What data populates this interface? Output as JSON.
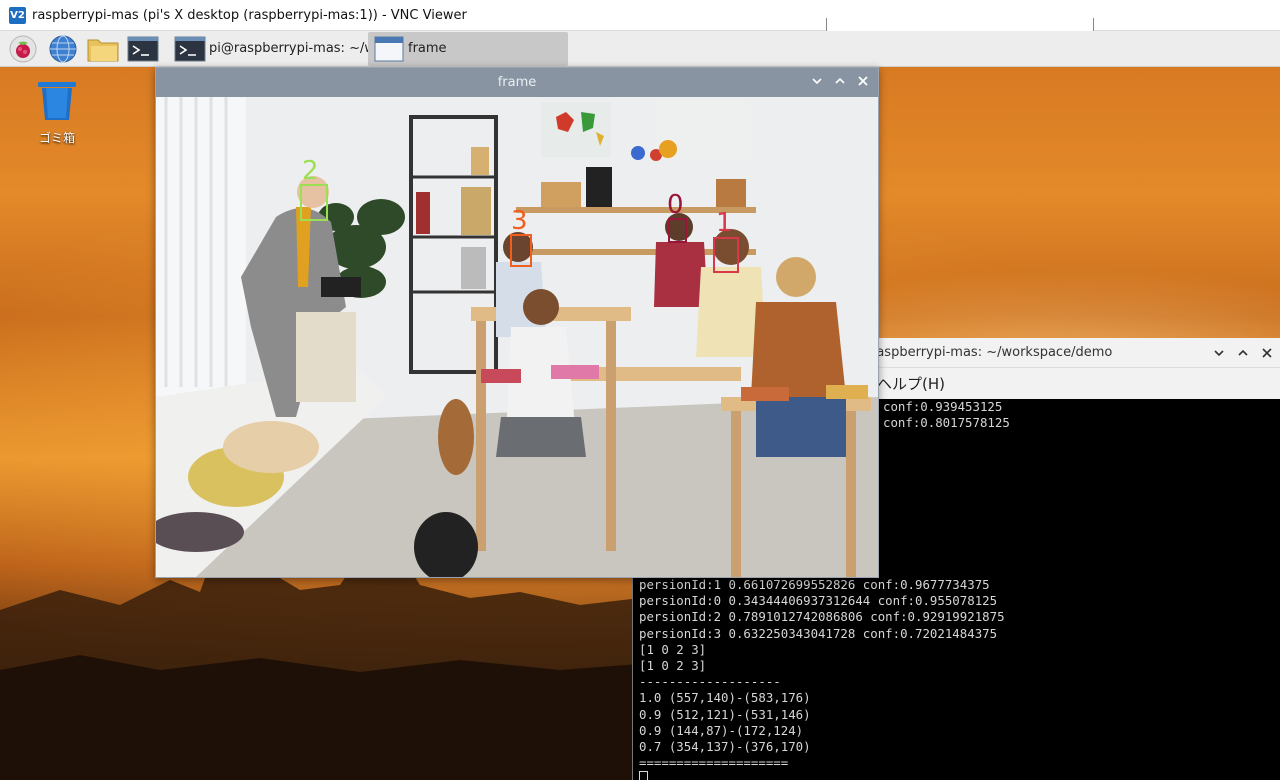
{
  "vnc": {
    "title": "raspberrypi-mas (pi's X desktop (raspberrypi-mas:1)) - VNC Viewer",
    "logo_text": "V2"
  },
  "panel": {
    "launchers": [
      "raspberry-menu-icon",
      "web-browser-icon",
      "file-manager-icon",
      "terminal-launcher-icon"
    ],
    "tasks": [
      {
        "label": "pi@raspberrypi-mas: ~/wo...",
        "icon": "terminal-icon"
      },
      {
        "label": "frame",
        "icon": "window-icon"
      }
    ]
  },
  "desktop": {
    "trash_label": "ゴミ箱"
  },
  "frame": {
    "title": "frame",
    "detections": [
      {
        "label": "2",
        "color": "#9be052"
      },
      {
        "label": "3",
        "color": "#f0601c"
      },
      {
        "label": "0",
        "color": "#9a1538"
      },
      {
        "label": "1",
        "color": "#d8384a"
      }
    ]
  },
  "terminal": {
    "title": "raspberrypi-mas: ~/workspace/demo",
    "menu": "ヘルプ(H)",
    "top_lines": [
      "conf:0.939453125",
      "conf:0.8017578125"
    ],
    "lines": [
      "persionId:1 0.661072699552826 conf:0.9677734375",
      "persionId:0 0.34344406937312644 conf:0.955078125",
      "persionId:2 0.7891012742086806 conf:0.92919921875",
      "persionId:3 0.632250343041728 conf:0.72021484375",
      "[1 0 2 3]",
      "[1 0 2 3]",
      "-------------------",
      "1.0 (557,140)-(583,176)",
      "0.9 (512,121)-(531,146)",
      "0.9 (144,87)-(172,124)",
      "0.7 (354,137)-(376,170)",
      "===================="
    ]
  }
}
